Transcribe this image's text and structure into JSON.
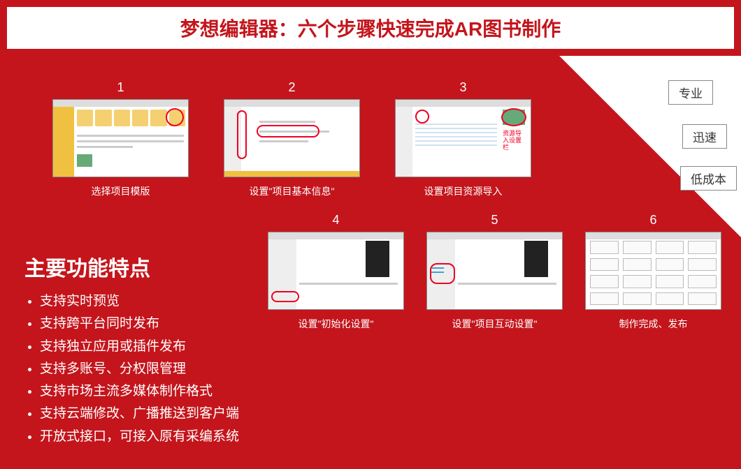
{
  "title": "梦想编辑器：六个步骤快速完成AR图书制作",
  "tags": [
    "专业",
    "迅速",
    "低成本"
  ],
  "steps": [
    {
      "num": "1",
      "caption": "选择项目模版"
    },
    {
      "num": "2",
      "caption": "设置\"项目基本信息\""
    },
    {
      "num": "3",
      "caption": "设置项目资源导入"
    },
    {
      "num": "4",
      "caption": "设置\"初始化设置\""
    },
    {
      "num": "5",
      "caption": "设置\"项目互动设置\""
    },
    {
      "num": "6",
      "caption": "制作完成、发布"
    }
  ],
  "features_title": "主要功能特点",
  "features": [
    "支持实时预览",
    "支持跨平台同时发布",
    "支持独立应用或插件发布",
    "支持多账号、分权限管理",
    "支持市场主流多媒体制作格式",
    "支持云端修改、广播推送到客户端",
    "开放式接口，可接入原有采编系统"
  ],
  "shot3_annotation": "资源导\n入设置\n栏"
}
